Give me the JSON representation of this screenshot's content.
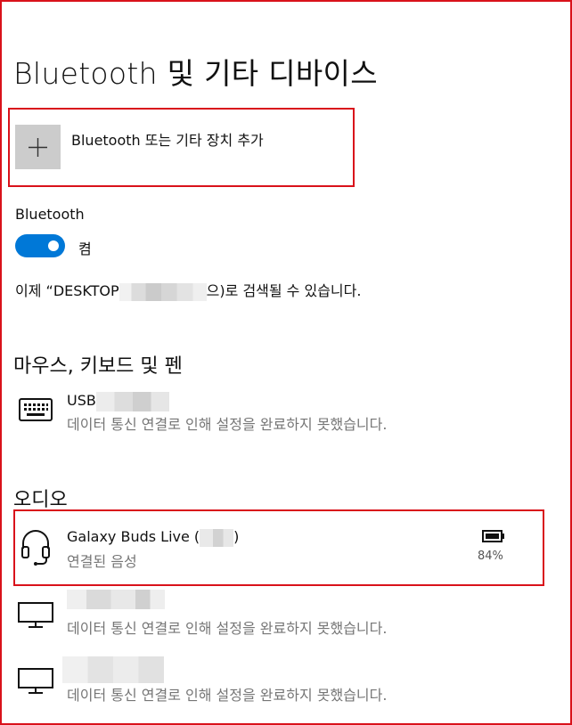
{
  "page": {
    "title": "Bluetooth 및 기타 디바이스"
  },
  "add_device": {
    "label": "Bluetooth 또는 기타 장치 추가",
    "icon": "plus-icon"
  },
  "bluetooth": {
    "label": "Bluetooth",
    "toggle_on": true,
    "toggle_state": "켬",
    "discoverable_prefix": "이제 “DESKTOP",
    "discoverable_suffix": "으)로 검색될 수 있습니다."
  },
  "sections": {
    "mouse_keyboard_pen": {
      "title": "마우스, 키보드 및 펜",
      "devices": [
        {
          "name": "USB",
          "status": "데이터 통신 연결로 인해 설정을 완료하지 못했습니다.",
          "icon": "keyboard-icon"
        }
      ]
    },
    "audio": {
      "title": "오디오",
      "devices": [
        {
          "name": "Galaxy Buds Live (",
          "name_suffix": ")",
          "status": "연결된 음성",
          "icon": "headset-icon",
          "battery": "84%",
          "battery_icon": "battery-icon",
          "selected": true
        },
        {
          "name": "",
          "status": "데이터 통신 연결로 인해 설정을 완료하지 못했습니다.",
          "icon": "monitor-icon"
        },
        {
          "name": "",
          "status": "데이터 통신 연결로 인해 설정을 완료하지 못했습니다.",
          "icon": "monitor-icon"
        }
      ]
    }
  },
  "colors": {
    "accent": "#0078d7",
    "highlight_border": "#d9121b",
    "secondary_text": "#767676",
    "button_bg": "#cccccc"
  }
}
